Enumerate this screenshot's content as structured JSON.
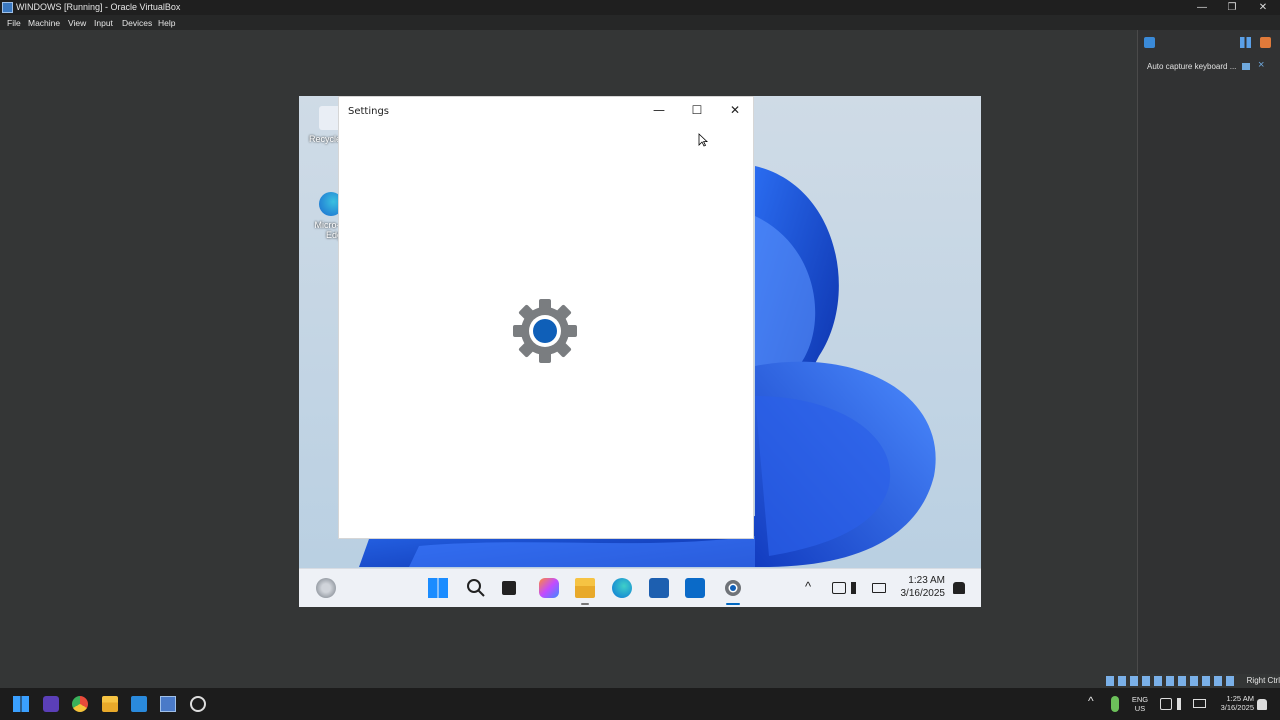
{
  "window": {
    "title": "WINDOWS [Running] - Oracle VirtualBox",
    "minimize_glyph": "—",
    "restore_glyph": "❐",
    "close_glyph": "✕"
  },
  "menu": [
    "File",
    "Machine",
    "View",
    "Input",
    "Devices",
    "Help"
  ],
  "right_panel": {
    "notification": "Auto capture keyboard ...",
    "close_glyph": "×"
  },
  "vm": {
    "desktop_icons": [
      "Recycle",
      "Micro-",
      "Edg"
    ],
    "settings_window": {
      "title": "Settings",
      "minimize_glyph": "—",
      "maximize_glyph": "☐",
      "close_glyph": "✕"
    },
    "taskbar": {
      "time": "1:23 AM",
      "date": "3/16/2025",
      "chevron": "^"
    }
  },
  "status_bar": {
    "host_key": "Right Ctrl"
  },
  "host_taskbar": {
    "lang_top": "ENG",
    "lang_bottom": "US",
    "time": "1:25 AM",
    "date": "3/16/2025",
    "chevron": "^"
  },
  "colors": {
    "accent_blue": "#0067c0",
    "wallpaper_blue": "#1a4fd6",
    "gear_gray": "#7a7d80"
  },
  "icons": [
    "windows-start-icon",
    "search-icon",
    "task-view-icon",
    "copilot-icon",
    "file-explorer-icon",
    "edge-icon",
    "store-icon",
    "outlook-icon",
    "settings-icon",
    "wifi-icon",
    "speaker-icon",
    "battery-icon",
    "bell-icon",
    "obs-icon",
    "chrome-icon",
    "folder-icon",
    "vscode-icon",
    "virtualbox-icon",
    "recorder-icon",
    "microphone-icon"
  ]
}
